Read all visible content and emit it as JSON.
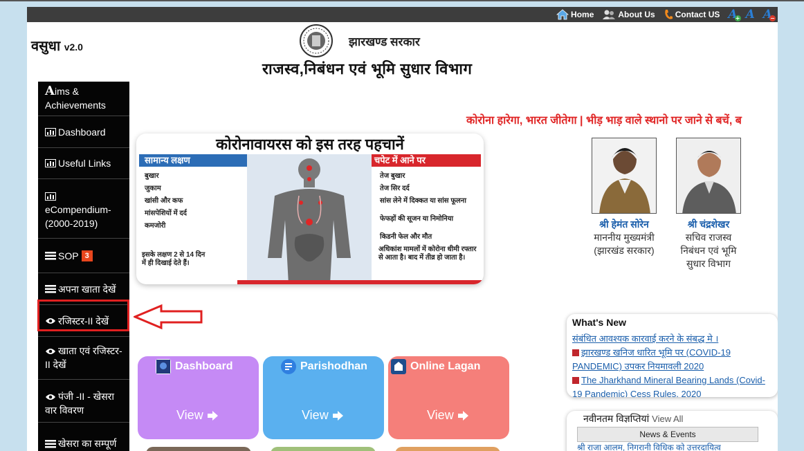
{
  "topnav": {
    "home": "Home",
    "about": "About Us",
    "contact": "Contact US",
    "font_btn": "A"
  },
  "header": {
    "brand": "वसुधा",
    "version": "v2.0",
    "gov": "झारखण्ड सरकार",
    "dept": "राजस्व,निबंधन एवं भूमि सुधार  विभाग"
  },
  "sidebar": {
    "items": [
      {
        "label": "ims & Achievements",
        "lead": "A"
      },
      {
        "label": "Dashboard"
      },
      {
        "label": "Useful Links"
      },
      {
        "label": "eCompendium-(2000-2019)"
      },
      {
        "label": "SOP",
        "badge": "3"
      },
      {
        "label": "अपना खाता देखें"
      },
      {
        "label": "रजिस्टर-II देखें"
      },
      {
        "label": "खाता एवं रजिस्टर-II देखें"
      },
      {
        "label": "पंजी -II - खेसरा वार विवरण"
      },
      {
        "label": "खेसरा का सम्पूर्ण विवरण देखें"
      }
    ]
  },
  "marquee": "कोरोना हारेगा, भारत जीतेगा | भीड़ भाड़ वाले स्थानो पर जाने से बचें, ब",
  "poster": {
    "title": "कोरोनावायरस को इस तरह पहचानें",
    "left_tab": "सामान्य लक्षण",
    "right_tab": "चपेट में आने पर",
    "left_symptoms": [
      "बुखार",
      "जुकाम",
      "खांसी और कफ",
      "मांसपेशियों में दर्द",
      "कमजोरी"
    ],
    "right_symptoms": [
      "तेज बुखार",
      "तेज सिर दर्द",
      "सांस लेने में दिक्कत या सांस फूलना",
      "फेफड़ों की सूजन या निमोनिया",
      "किडनी फेल और मौत"
    ],
    "left_foot": "इसके लक्षण 2 से 14 दिन में ही दिखाई देते हैं।",
    "right_foot": "अधिकांश मामलों में कोरोना धीमी रफ्तार से आता है। बाद में तीव्र हो जाता है।"
  },
  "people": [
    {
      "name": "श्री हेमंत सोरेन",
      "desig": "माननीय मुख्यमंत्री (झारखंड सरकार)"
    },
    {
      "name": "श्री चंद्रशेखर",
      "desig": "सचिव राजस्व निबंधन एवं भूमि सुधार विभाग"
    }
  ],
  "whats_new": {
    "title": "What's New",
    "items": [
      "संबंधित आवश्यक कारवाई करने के संबद्ध मे ।",
      "झारखण्ड खनिज धारित भूमि पर (COVID-19 PANDEMIC) उपकर नियमावली 2020",
      "The Jharkhand Mineral Bearing Lands (Covid-19 Pandemic) Cess Rules, 2020"
    ]
  },
  "notifications": {
    "title": "नवीनतम विज्ञप्तियां",
    "view_all": "View All",
    "tab": "News & Events",
    "row": "श्री राजा आलम, निगरानी विधिक को उत्तरदायित्व"
  },
  "tiles": [
    {
      "label": "Dashboard",
      "view": "View",
      "color": "#c58af5"
    },
    {
      "label": "Parishodhan",
      "view": "View",
      "color": "#5ab0ef"
    },
    {
      "label": "Online Lagan",
      "view": "View",
      "color": "#f57f7a"
    }
  ]
}
